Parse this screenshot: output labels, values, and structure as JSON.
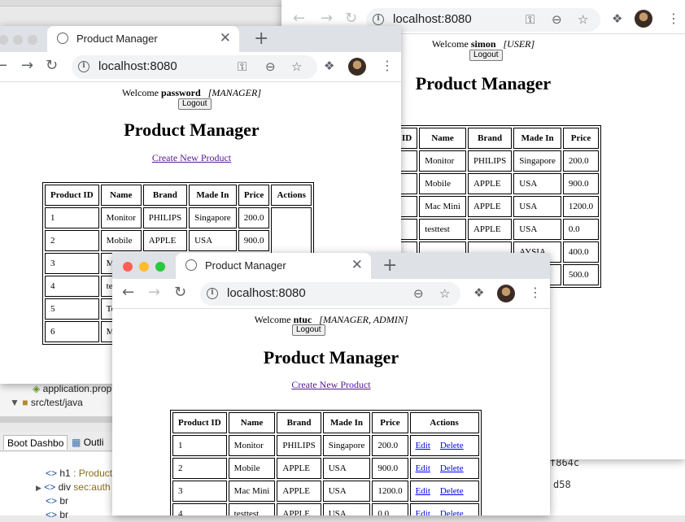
{
  "ide": {
    "tree": {
      "file_item": "application.prop",
      "folder_item": "src/test/java"
    },
    "tabs": {
      "boot_dashboard": "Boot Dashbo",
      "outline": "Outli"
    },
    "outline": [
      {
        "tag": "h1",
        "rest": " : Product"
      },
      {
        "tag": "div",
        "rest": " sec:auth"
      },
      {
        "tag": "br",
        "rest": ""
      },
      {
        "tag": "br",
        "rest": ""
      }
    ],
    "editor_fragments": [
      "f864c",
      "d58"
    ]
  },
  "windows": {
    "user": {
      "url": "localhost:8080",
      "welcome_prefix": "Welcome",
      "username": "simon",
      "roles": "[USER]",
      "logout_label": "Logout",
      "heading": "Product Manager",
      "columns": [
        "ID",
        "Name",
        "Brand",
        "Made In",
        "Price"
      ],
      "rows": [
        [
          "",
          "Monitor",
          "PHILIPS",
          "Singapore",
          "200.0"
        ],
        [
          "",
          "Mobile",
          "APPLE",
          "USA",
          "900.0"
        ],
        [
          "",
          "Mac Mini",
          "APPLE",
          "USA",
          "1200.0"
        ],
        [
          "",
          "testtest",
          "APPLE",
          "USA",
          "0.0"
        ],
        [
          "",
          "",
          "",
          "AYSIA",
          "400.0"
        ],
        [
          "",
          "",
          "",
          "A",
          "500.0"
        ]
      ]
    },
    "manager": {
      "tab_title": "Product Manager",
      "url": "localhost:8080",
      "welcome_prefix": "Welcome",
      "username": "password",
      "roles": "[MANAGER]",
      "logout_label": "Logout",
      "heading": "Product Manager",
      "create_link": "Create New Product",
      "columns": [
        "Product ID",
        "Name",
        "Brand",
        "Made In",
        "Price",
        "Actions"
      ],
      "rows": [
        [
          "1",
          "Monitor",
          "PHILIPS",
          "Singapore",
          "200.0"
        ],
        [
          "2",
          "Mobile",
          "APPLE",
          "USA",
          "900.0"
        ],
        [
          "3",
          "M",
          "",
          "",
          ""
        ],
        [
          "4",
          "tes",
          "",
          "",
          ""
        ],
        [
          "5",
          "To",
          "",
          "",
          ""
        ],
        [
          "6",
          "M",
          "",
          "",
          ""
        ]
      ]
    },
    "admin": {
      "tab_title": "Product Manager",
      "url": "localhost:8080",
      "welcome_prefix": "Welcome",
      "username": "ntuc",
      "roles": "[MANAGER, ADMIN]",
      "logout_label": "Logout",
      "heading": "Product Manager",
      "create_link": "Create New Product",
      "columns": [
        "Product ID",
        "Name",
        "Brand",
        "Made In",
        "Price",
        "Actions"
      ],
      "edit_label": "Edit",
      "delete_label": "Delete",
      "rows": [
        [
          "1",
          "Monitor",
          "PHILIPS",
          "Singapore",
          "200.0"
        ],
        [
          "2",
          "Mobile",
          "APPLE",
          "USA",
          "900.0"
        ],
        [
          "3",
          "Mac Mini",
          "APPLE",
          "USA",
          "1200.0"
        ],
        [
          "4",
          "testtest",
          "APPLE",
          "USA",
          "0.0"
        ]
      ]
    }
  },
  "colors": {
    "traffic_close": "#ff5f57",
    "traffic_min": "#febc2e",
    "traffic_max": "#28c840",
    "traffic_inactive": "#cfcfcf",
    "link_visited": "#551a8b",
    "link": "#0000ee"
  },
  "icons": [
    "info-icon",
    "key-icon",
    "zoom-icon",
    "star-icon",
    "extensions-icon",
    "menu-icon",
    "globe-icon",
    "back-icon",
    "forward-icon",
    "reload-icon"
  ]
}
